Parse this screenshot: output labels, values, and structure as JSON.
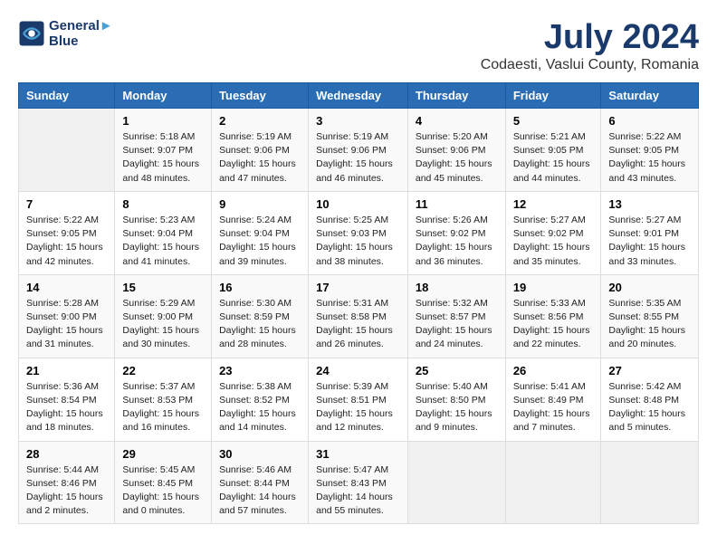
{
  "header": {
    "logo_line1": "General",
    "logo_line2": "Blue",
    "title": "July 2024",
    "location": "Codaesti, Vaslui County, Romania"
  },
  "weekdays": [
    "Sunday",
    "Monday",
    "Tuesday",
    "Wednesday",
    "Thursday",
    "Friday",
    "Saturday"
  ],
  "weeks": [
    [
      {
        "day": "",
        "empty": true
      },
      {
        "day": "1",
        "sunrise": "Sunrise: 5:18 AM",
        "sunset": "Sunset: 9:07 PM",
        "daylight": "Daylight: 15 hours and 48 minutes."
      },
      {
        "day": "2",
        "sunrise": "Sunrise: 5:19 AM",
        "sunset": "Sunset: 9:06 PM",
        "daylight": "Daylight: 15 hours and 47 minutes."
      },
      {
        "day": "3",
        "sunrise": "Sunrise: 5:19 AM",
        "sunset": "Sunset: 9:06 PM",
        "daylight": "Daylight: 15 hours and 46 minutes."
      },
      {
        "day": "4",
        "sunrise": "Sunrise: 5:20 AM",
        "sunset": "Sunset: 9:06 PM",
        "daylight": "Daylight: 15 hours and 45 minutes."
      },
      {
        "day": "5",
        "sunrise": "Sunrise: 5:21 AM",
        "sunset": "Sunset: 9:05 PM",
        "daylight": "Daylight: 15 hours and 44 minutes."
      },
      {
        "day": "6",
        "sunrise": "Sunrise: 5:22 AM",
        "sunset": "Sunset: 9:05 PM",
        "daylight": "Daylight: 15 hours and 43 minutes."
      }
    ],
    [
      {
        "day": "7",
        "sunrise": "Sunrise: 5:22 AM",
        "sunset": "Sunset: 9:05 PM",
        "daylight": "Daylight: 15 hours and 42 minutes."
      },
      {
        "day": "8",
        "sunrise": "Sunrise: 5:23 AM",
        "sunset": "Sunset: 9:04 PM",
        "daylight": "Daylight: 15 hours and 41 minutes."
      },
      {
        "day": "9",
        "sunrise": "Sunrise: 5:24 AM",
        "sunset": "Sunset: 9:04 PM",
        "daylight": "Daylight: 15 hours and 39 minutes."
      },
      {
        "day": "10",
        "sunrise": "Sunrise: 5:25 AM",
        "sunset": "Sunset: 9:03 PM",
        "daylight": "Daylight: 15 hours and 38 minutes."
      },
      {
        "day": "11",
        "sunrise": "Sunrise: 5:26 AM",
        "sunset": "Sunset: 9:02 PM",
        "daylight": "Daylight: 15 hours and 36 minutes."
      },
      {
        "day": "12",
        "sunrise": "Sunrise: 5:27 AM",
        "sunset": "Sunset: 9:02 PM",
        "daylight": "Daylight: 15 hours and 35 minutes."
      },
      {
        "day": "13",
        "sunrise": "Sunrise: 5:27 AM",
        "sunset": "Sunset: 9:01 PM",
        "daylight": "Daylight: 15 hours and 33 minutes."
      }
    ],
    [
      {
        "day": "14",
        "sunrise": "Sunrise: 5:28 AM",
        "sunset": "Sunset: 9:00 PM",
        "daylight": "Daylight: 15 hours and 31 minutes."
      },
      {
        "day": "15",
        "sunrise": "Sunrise: 5:29 AM",
        "sunset": "Sunset: 9:00 PM",
        "daylight": "Daylight: 15 hours and 30 minutes."
      },
      {
        "day": "16",
        "sunrise": "Sunrise: 5:30 AM",
        "sunset": "Sunset: 8:59 PM",
        "daylight": "Daylight: 15 hours and 28 minutes."
      },
      {
        "day": "17",
        "sunrise": "Sunrise: 5:31 AM",
        "sunset": "Sunset: 8:58 PM",
        "daylight": "Daylight: 15 hours and 26 minutes."
      },
      {
        "day": "18",
        "sunrise": "Sunrise: 5:32 AM",
        "sunset": "Sunset: 8:57 PM",
        "daylight": "Daylight: 15 hours and 24 minutes."
      },
      {
        "day": "19",
        "sunrise": "Sunrise: 5:33 AM",
        "sunset": "Sunset: 8:56 PM",
        "daylight": "Daylight: 15 hours and 22 minutes."
      },
      {
        "day": "20",
        "sunrise": "Sunrise: 5:35 AM",
        "sunset": "Sunset: 8:55 PM",
        "daylight": "Daylight: 15 hours and 20 minutes."
      }
    ],
    [
      {
        "day": "21",
        "sunrise": "Sunrise: 5:36 AM",
        "sunset": "Sunset: 8:54 PM",
        "daylight": "Daylight: 15 hours and 18 minutes."
      },
      {
        "day": "22",
        "sunrise": "Sunrise: 5:37 AM",
        "sunset": "Sunset: 8:53 PM",
        "daylight": "Daylight: 15 hours and 16 minutes."
      },
      {
        "day": "23",
        "sunrise": "Sunrise: 5:38 AM",
        "sunset": "Sunset: 8:52 PM",
        "daylight": "Daylight: 15 hours and 14 minutes."
      },
      {
        "day": "24",
        "sunrise": "Sunrise: 5:39 AM",
        "sunset": "Sunset: 8:51 PM",
        "daylight": "Daylight: 15 hours and 12 minutes."
      },
      {
        "day": "25",
        "sunrise": "Sunrise: 5:40 AM",
        "sunset": "Sunset: 8:50 PM",
        "daylight": "Daylight: 15 hours and 9 minutes."
      },
      {
        "day": "26",
        "sunrise": "Sunrise: 5:41 AM",
        "sunset": "Sunset: 8:49 PM",
        "daylight": "Daylight: 15 hours and 7 minutes."
      },
      {
        "day": "27",
        "sunrise": "Sunrise: 5:42 AM",
        "sunset": "Sunset: 8:48 PM",
        "daylight": "Daylight: 15 hours and 5 minutes."
      }
    ],
    [
      {
        "day": "28",
        "sunrise": "Sunrise: 5:44 AM",
        "sunset": "Sunset: 8:46 PM",
        "daylight": "Daylight: 15 hours and 2 minutes."
      },
      {
        "day": "29",
        "sunrise": "Sunrise: 5:45 AM",
        "sunset": "Sunset: 8:45 PM",
        "daylight": "Daylight: 15 hours and 0 minutes."
      },
      {
        "day": "30",
        "sunrise": "Sunrise: 5:46 AM",
        "sunset": "Sunset: 8:44 PM",
        "daylight": "Daylight: 14 hours and 57 minutes."
      },
      {
        "day": "31",
        "sunrise": "Sunrise: 5:47 AM",
        "sunset": "Sunset: 8:43 PM",
        "daylight": "Daylight: 14 hours and 55 minutes."
      },
      {
        "day": "",
        "empty": true
      },
      {
        "day": "",
        "empty": true
      },
      {
        "day": "",
        "empty": true
      }
    ]
  ]
}
